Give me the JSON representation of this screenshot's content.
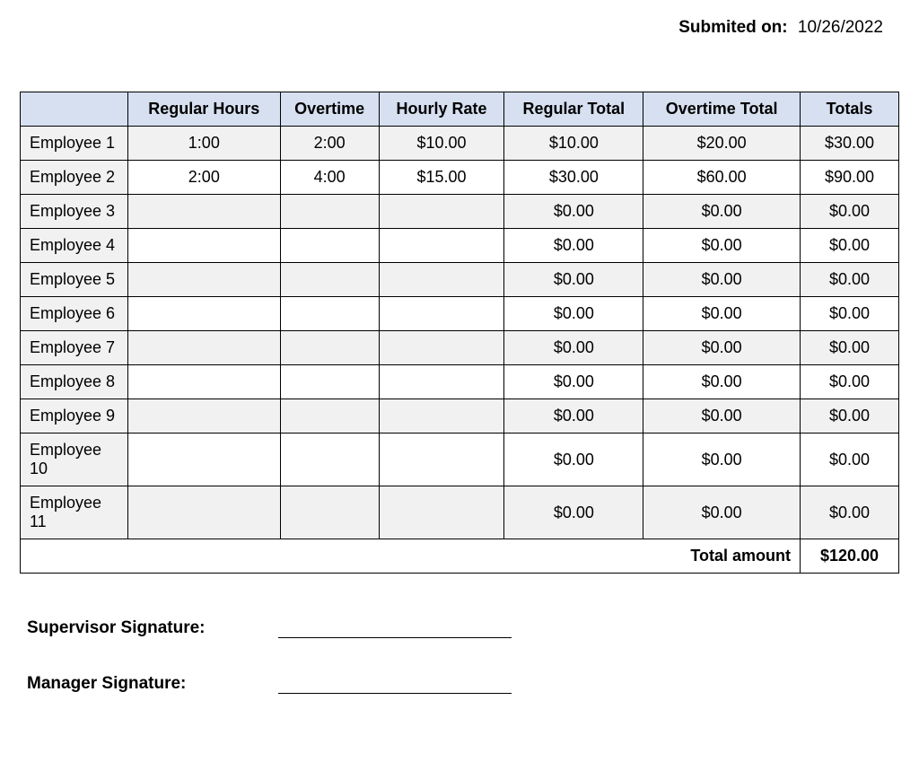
{
  "submitted": {
    "label": "Submited on:",
    "date": "10/26/2022"
  },
  "table": {
    "headers": {
      "corner": "",
      "regular_hours": "Regular Hours",
      "overtime": "Overtime",
      "hourly_rate": "Hourly Rate",
      "regular_total": "Regular Total",
      "overtime_total": "Overtime Total",
      "totals": "Totals"
    },
    "rows": [
      {
        "employee": "Employee 1",
        "regular_hours": "1:00",
        "overtime": "2:00",
        "hourly_rate": "$10.00",
        "regular_total": "$10.00",
        "overtime_total": "$20.00",
        "total": "$30.00"
      },
      {
        "employee": "Employee 2",
        "regular_hours": "2:00",
        "overtime": "4:00",
        "hourly_rate": "$15.00",
        "regular_total": "$30.00",
        "overtime_total": "$60.00",
        "total": "$90.00"
      },
      {
        "employee": "Employee 3",
        "regular_hours": "",
        "overtime": "",
        "hourly_rate": "",
        "regular_total": "$0.00",
        "overtime_total": "$0.00",
        "total": "$0.00"
      },
      {
        "employee": "Employee 4",
        "regular_hours": "",
        "overtime": "",
        "hourly_rate": "",
        "regular_total": "$0.00",
        "overtime_total": "$0.00",
        "total": "$0.00"
      },
      {
        "employee": "Employee 5",
        "regular_hours": "",
        "overtime": "",
        "hourly_rate": "",
        "regular_total": "$0.00",
        "overtime_total": "$0.00",
        "total": "$0.00"
      },
      {
        "employee": "Employee 6",
        "regular_hours": "",
        "overtime": "",
        "hourly_rate": "",
        "regular_total": "$0.00",
        "overtime_total": "$0.00",
        "total": "$0.00"
      },
      {
        "employee": "Employee 7",
        "regular_hours": "",
        "overtime": "",
        "hourly_rate": "",
        "regular_total": "$0.00",
        "overtime_total": "$0.00",
        "total": "$0.00"
      },
      {
        "employee": "Employee 8",
        "regular_hours": "",
        "overtime": "",
        "hourly_rate": "",
        "regular_total": "$0.00",
        "overtime_total": "$0.00",
        "total": "$0.00"
      },
      {
        "employee": "Employee 9",
        "regular_hours": "",
        "overtime": "",
        "hourly_rate": "",
        "regular_total": "$0.00",
        "overtime_total": "$0.00",
        "total": "$0.00"
      },
      {
        "employee": "Employee 10",
        "regular_hours": "",
        "overtime": "",
        "hourly_rate": "",
        "regular_total": "$0.00",
        "overtime_total": "$0.00",
        "total": "$0.00"
      },
      {
        "employee": "Employee 11",
        "regular_hours": "",
        "overtime": "",
        "hourly_rate": "",
        "regular_total": "$0.00",
        "overtime_total": "$0.00",
        "total": "$0.00"
      }
    ],
    "footer": {
      "label": "Total amount",
      "value": "$120.00"
    }
  },
  "signatures": {
    "supervisor_label": "Supervisor Signature:",
    "manager_label": "Manager Signature:"
  },
  "chart_data": {
    "type": "table",
    "title": "Employee time / pay summary",
    "columns": [
      "Employee",
      "Regular Hours",
      "Overtime",
      "Hourly Rate",
      "Regular Total",
      "Overtime Total",
      "Totals"
    ],
    "rows": [
      [
        "Employee 1",
        "1:00",
        "2:00",
        "$10.00",
        "$10.00",
        "$20.00",
        "$30.00"
      ],
      [
        "Employee 2",
        "2:00",
        "4:00",
        "$15.00",
        "$30.00",
        "$60.00",
        "$90.00"
      ],
      [
        "Employee 3",
        "",
        "",
        "",
        "$0.00",
        "$0.00",
        "$0.00"
      ],
      [
        "Employee 4",
        "",
        "",
        "",
        "$0.00",
        "$0.00",
        "$0.00"
      ],
      [
        "Employee 5",
        "",
        "",
        "",
        "$0.00",
        "$0.00",
        "$0.00"
      ],
      [
        "Employee 6",
        "",
        "",
        "",
        "$0.00",
        "$0.00",
        "$0.00"
      ],
      [
        "Employee 7",
        "",
        "",
        "",
        "$0.00",
        "$0.00",
        "$0.00"
      ],
      [
        "Employee 8",
        "",
        "",
        "",
        "$0.00",
        "$0.00",
        "$0.00"
      ],
      [
        "Employee 9",
        "",
        "",
        "",
        "$0.00",
        "$0.00",
        "$0.00"
      ],
      [
        "Employee 10",
        "",
        "",
        "",
        "$0.00",
        "$0.00",
        "$0.00"
      ],
      [
        "Employee 11",
        "",
        "",
        "",
        "$0.00",
        "$0.00",
        "$0.00"
      ]
    ],
    "total_amount": "$120.00"
  }
}
